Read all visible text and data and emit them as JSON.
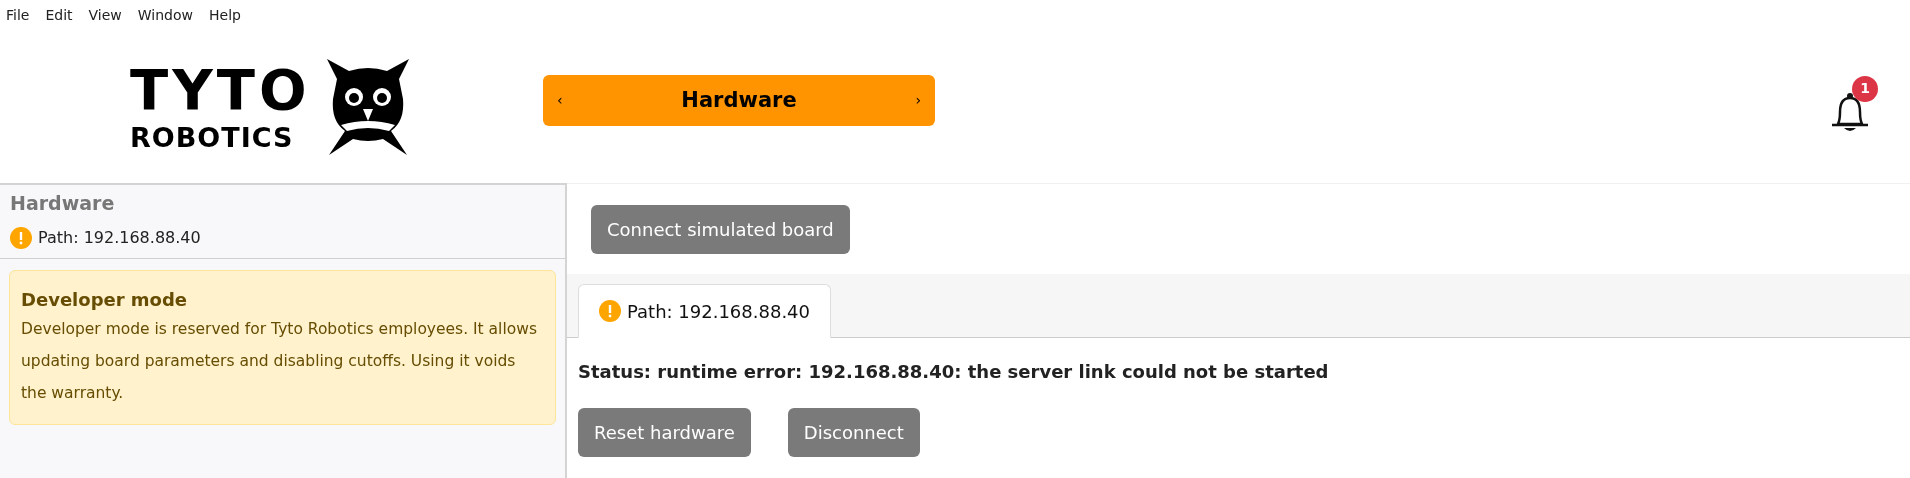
{
  "menu": [
    "File",
    "Edit",
    "View",
    "Window",
    "Help"
  ],
  "logo": {
    "line1": "TYTO",
    "line2": "ROBOTICS"
  },
  "page_switcher": {
    "prev": "‹",
    "title": "Hardware",
    "next": "›"
  },
  "notifications": {
    "count": "1"
  },
  "sidebar": {
    "title": "Hardware",
    "path": {
      "text": "Path: 192.168.88.40",
      "warning": true
    },
    "alert": {
      "title": "Developer mode",
      "text": "Developer mode is reserved for Tyto Robotics employees. It allows updating board parameters and disabling cutoffs. Using it voids the warranty."
    }
  },
  "main": {
    "connect_button": "Connect simulated board",
    "tabs": [
      {
        "label": "Path: 192.168.88.40",
        "warning": true,
        "selected": true
      }
    ],
    "status": "Status: runtime error: 192.168.88.40: the server link could not be started",
    "buttons": [
      "Reset hardware",
      "Disconnect"
    ]
  }
}
